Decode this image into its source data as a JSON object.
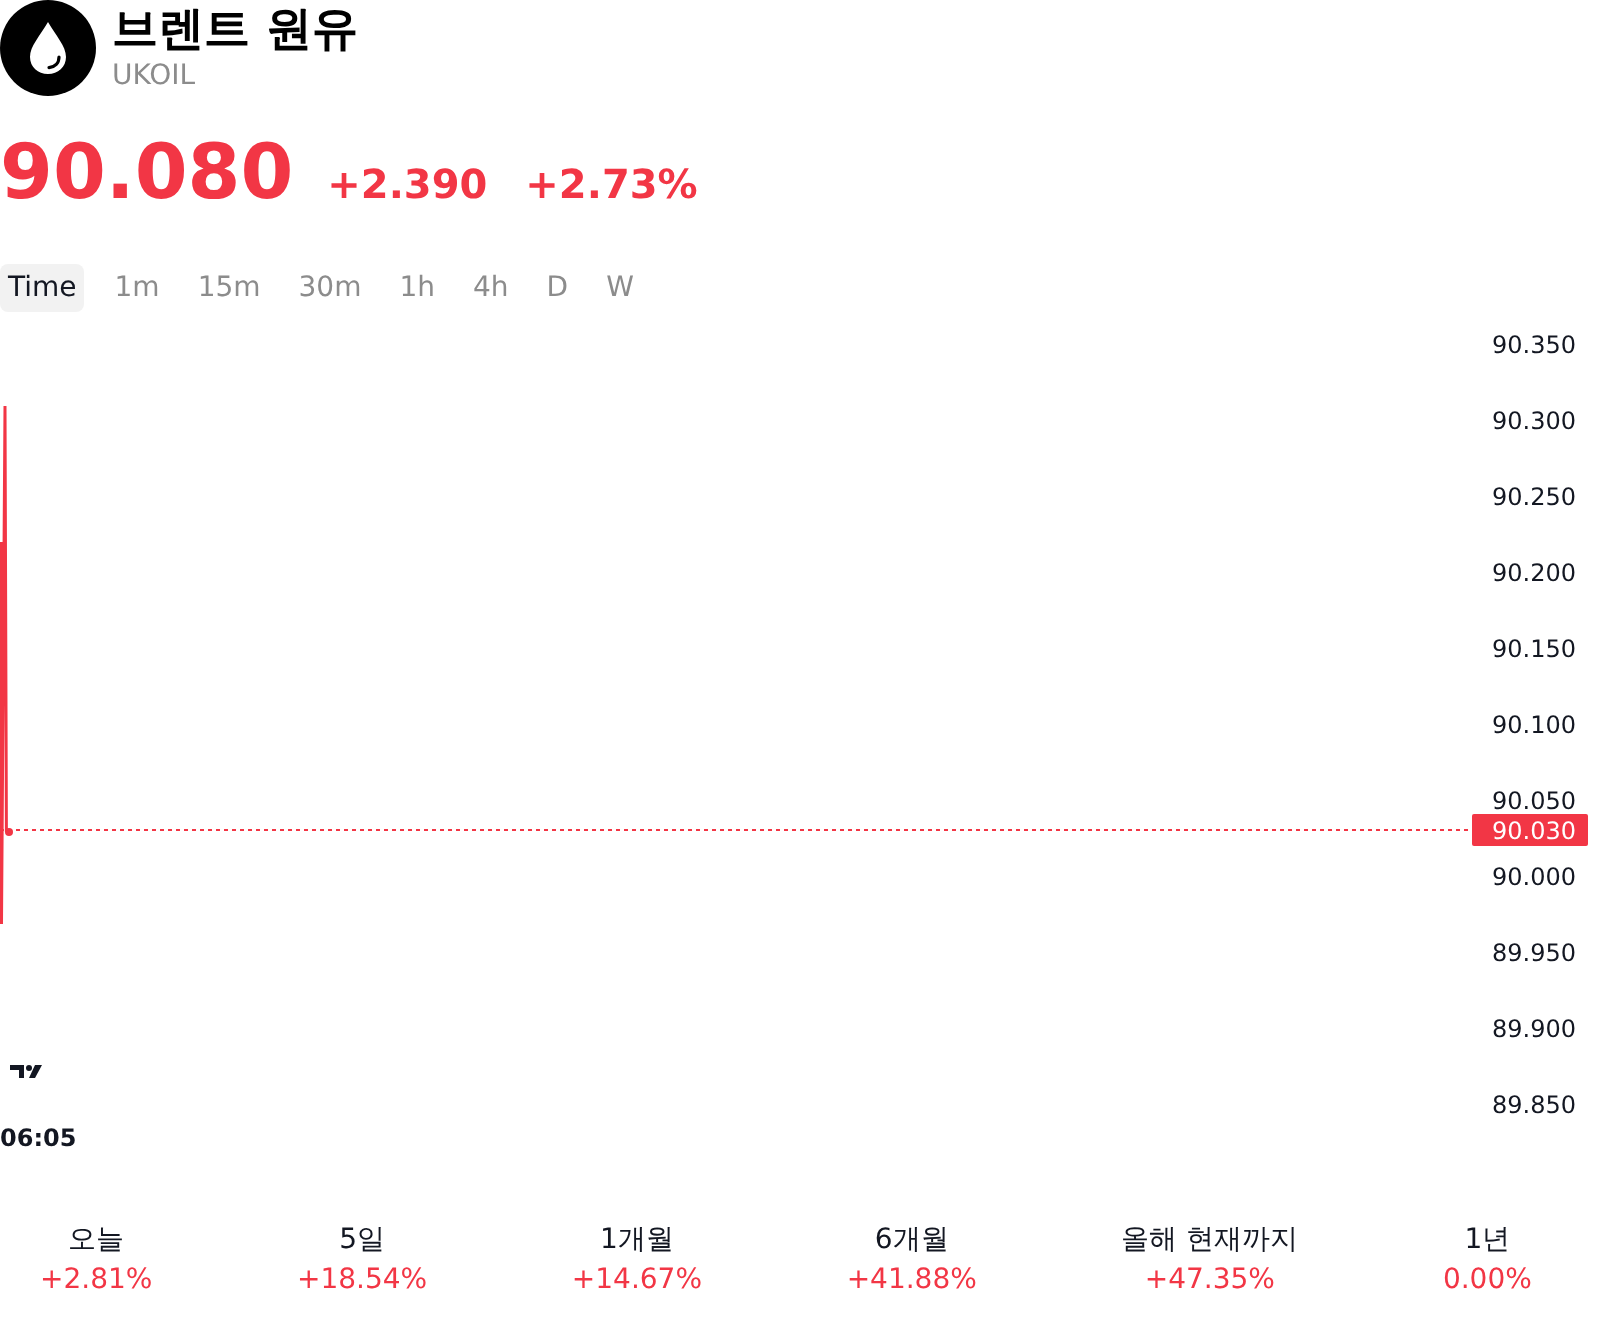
{
  "header": {
    "title": "브렌트 원유",
    "symbol": "UKOIL"
  },
  "quote": {
    "price": "90.080",
    "change": "+2.390",
    "change_percent": "+2.73%"
  },
  "intervals": [
    {
      "label": "Time",
      "selected": true
    },
    {
      "label": "1m",
      "selected": false
    },
    {
      "label": "15m",
      "selected": false
    },
    {
      "label": "30m",
      "selected": false
    },
    {
      "label": "1h",
      "selected": false
    },
    {
      "label": "4h",
      "selected": false
    },
    {
      "label": "D",
      "selected": false
    },
    {
      "label": "W",
      "selected": false
    }
  ],
  "chart": {
    "price_scale": [
      "90.350",
      "90.300",
      "90.250",
      "90.200",
      "90.150",
      "90.100",
      "90.050",
      "90.000",
      "89.950",
      "89.900",
      "89.850"
    ],
    "last_price_tag": "90.030",
    "time_label": "06:05"
  },
  "performance": [
    {
      "label": "오늘",
      "value": "+2.81%"
    },
    {
      "label": "5일",
      "value": "+18.54%"
    },
    {
      "label": "1개월",
      "value": "+14.67%"
    },
    {
      "label": "6개월",
      "value": "+41.88%"
    },
    {
      "label": "올해 현재까지",
      "value": "+47.35%"
    },
    {
      "label": "1년",
      "value": "0.00%"
    }
  ]
}
